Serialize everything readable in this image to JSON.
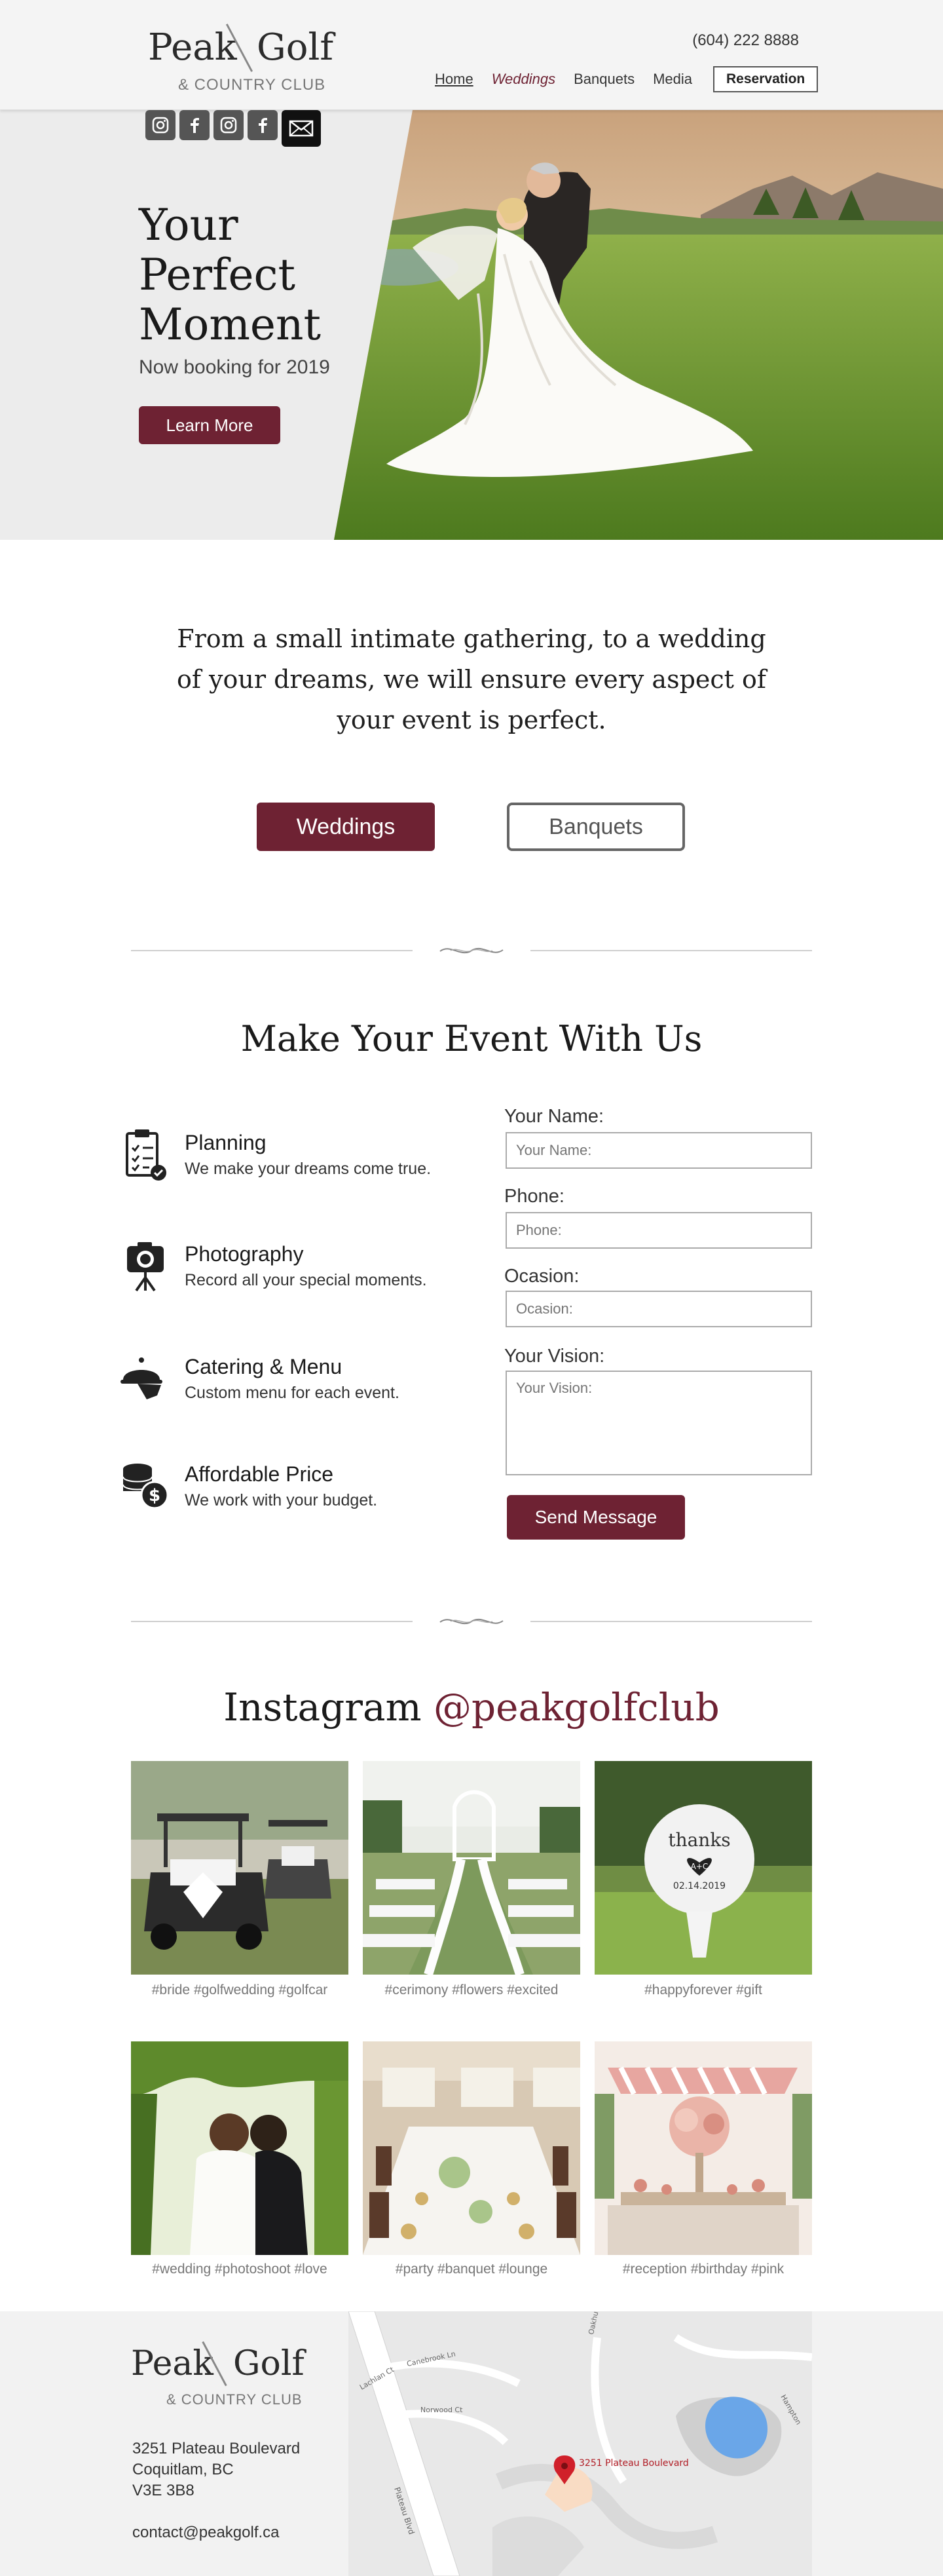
{
  "brand": {
    "name_left": "Peak",
    "name_right": "Golf",
    "sub": "& COUNTRY CLUB"
  },
  "header": {
    "phone": "(604) 222 8888",
    "nav": [
      "Home",
      "Weddings",
      "Banquets",
      "Media"
    ],
    "reservation": "Reservation"
  },
  "social": [
    "instagram-icon",
    "facebook-icon",
    "instagram-icon",
    "facebook-icon",
    "mail-icon"
  ],
  "hero": {
    "title": "Your Perfect Moment",
    "subtitle": "Now booking for 2019",
    "button": "Learn More"
  },
  "intro": {
    "text": "From a small intimate gathering, to a wedding of your dreams, we will ensure every aspect of your event is perfect.",
    "btn_weddings": "Weddings",
    "btn_banquets": "Banquets"
  },
  "event": {
    "title": "Make Your Event With Us",
    "features": [
      {
        "title": "Planning",
        "desc": "We make your dreams come true.",
        "icon": "clipboard-icon"
      },
      {
        "title": "Photography",
        "desc": "Record all your special moments.",
        "icon": "camera-icon"
      },
      {
        "title": "Catering & Menu",
        "desc": "Custom menu for each event.",
        "icon": "cloche-icon"
      },
      {
        "title": "Affordable Price",
        "desc": "We work with your budget.",
        "icon": "coins-icon"
      }
    ],
    "form": {
      "name_label": "Your Name:",
      "name_placeholder": "Your Name:",
      "phone_label": "Phone:",
      "phone_placeholder": "Phone:",
      "occasion_label": "Ocasion:",
      "occasion_placeholder": "Ocasion:",
      "vision_label": "Your Vision:",
      "vision_placeholder": "Your Vision:",
      "send": "Send Message"
    }
  },
  "instagram": {
    "title": "Instagram",
    "handle": "@peakgolfclub",
    "tags": [
      "#bride #golfwedding #golfcar",
      "#cerimony #flowers #excited",
      "#happyforever #gift",
      "#wedding #photoshoot #love",
      "#party #banquet #lounge",
      "#reception #birthday #pink"
    ],
    "ball_text": "thanks",
    "ball_initials": "A+C",
    "ball_date": "02.14.2019"
  },
  "footer": {
    "address": [
      "3251 Plateau Boulevard",
      "Coquitlam, BC",
      "V3E 3B8"
    ],
    "email": "contact@peakgolf.ca"
  },
  "map": {
    "pin_label": "3251 Plateau Boulevard",
    "streets": [
      "Plateau Blvd",
      "Canebrook Ln",
      "Norwood Ct",
      "Oakhurst Ln",
      "Lachlan Ct",
      "Hampton"
    ]
  },
  "colors": {
    "accent": "#6e2233",
    "header_bg": "#f4f4f4",
    "hero_bg": "#ececec"
  }
}
